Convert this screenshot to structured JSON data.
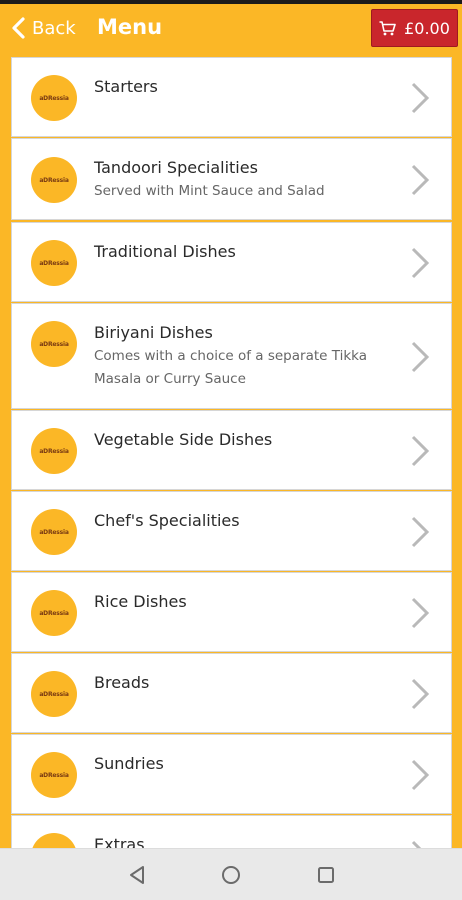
{
  "header": {
    "back_label": "Back",
    "title": "Menu",
    "cart_total": "£0.00"
  },
  "colors": {
    "brand": "#fbb726",
    "cart": "#c9262c"
  },
  "menu": {
    "logo_text": "aDRessia",
    "items": [
      {
        "title": "Starters",
        "desc": ""
      },
      {
        "title": "Tandoori Specialities",
        "desc": "Served with Mint Sauce and Salad"
      },
      {
        "title": "Traditional Dishes",
        "desc": ""
      },
      {
        "title": "Biriyani Dishes",
        "desc": "Comes with a choice of a separate Tikka Masala or Curry Sauce"
      },
      {
        "title": "Vegetable Side Dishes",
        "desc": ""
      },
      {
        "title": "Chef's Specialities",
        "desc": ""
      },
      {
        "title": "Rice Dishes",
        "desc": ""
      },
      {
        "title": "Breads",
        "desc": ""
      },
      {
        "title": "Sundries",
        "desc": ""
      },
      {
        "title": "Extras",
        "desc": ""
      }
    ]
  },
  "navbar": {
    "icons": [
      "back-triangle-icon",
      "home-circle-icon",
      "recents-square-icon"
    ]
  }
}
